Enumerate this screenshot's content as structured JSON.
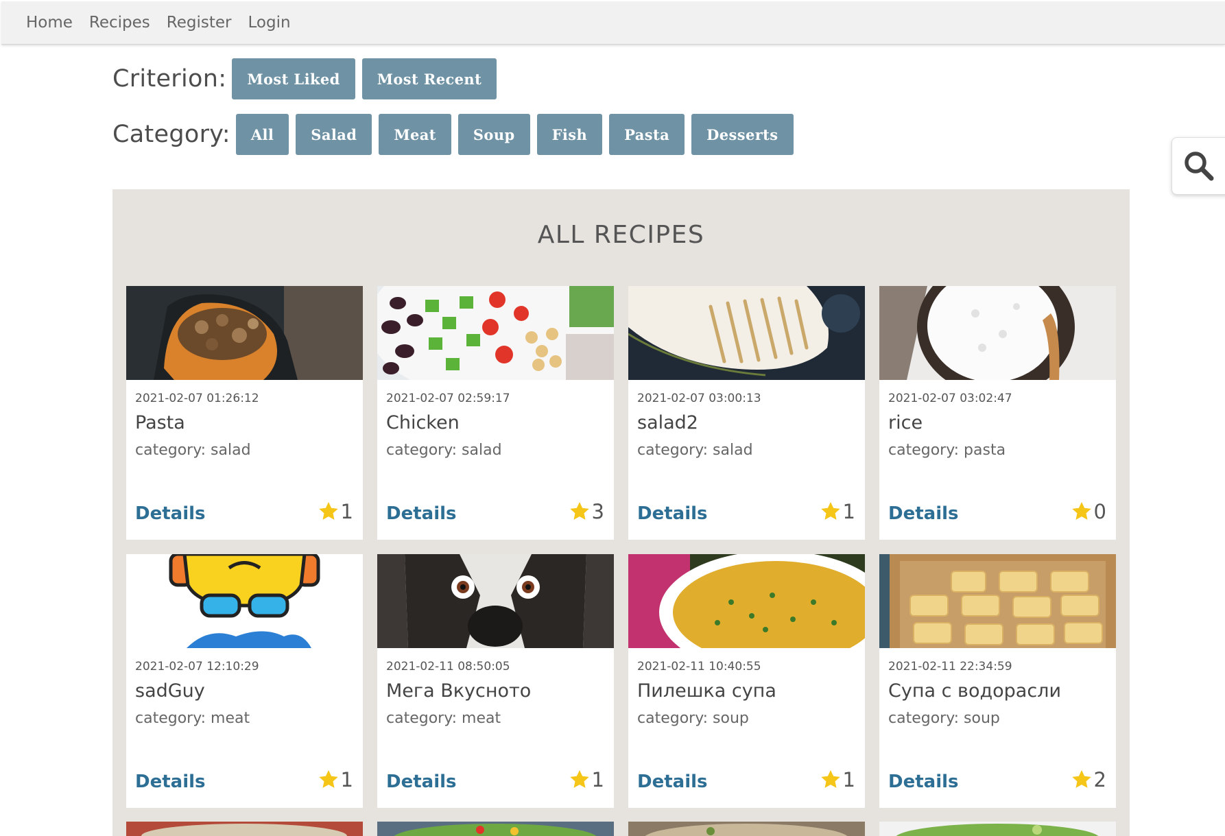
{
  "nav": {
    "items": [
      "Home",
      "Recipes",
      "Register",
      "Login"
    ]
  },
  "filters": {
    "criterion_label": "Criterion:",
    "criterion_buttons": [
      "Most Liked",
      "Most Recent"
    ],
    "category_label": "Category:",
    "category_buttons": [
      "All",
      "Salad",
      "Meat",
      "Soup",
      "Fish",
      "Pasta",
      "Desserts"
    ]
  },
  "search": {
    "icon": "search-icon"
  },
  "panel": {
    "title": "ALL RECIPES",
    "details_label": "Details",
    "recipes": [
      {
        "date": "2021-02-07 01:26:12",
        "title": "Pasta",
        "category": "category: salad",
        "likes": "1",
        "image": "stuffed-squash-mushrooms"
      },
      {
        "date": "2021-02-07 02:59:17",
        "title": "Chicken",
        "category": "category: salad",
        "likes": "3",
        "image": "vegetable-salad-bowl"
      },
      {
        "date": "2021-02-07 03:00:13",
        "title": "salad2",
        "category": "category: salad",
        "likes": "1",
        "image": "grilled-fish-fillet"
      },
      {
        "date": "2021-02-07 03:02:47",
        "title": "rice",
        "category": "category: pasta",
        "likes": "0",
        "image": "bowl-of-rice"
      },
      {
        "date": "2021-02-07 12:10:29",
        "title": "sadGuy",
        "category": "category: meat",
        "likes": "1",
        "image": "cartoon-character"
      },
      {
        "date": "2021-02-11 08:50:05",
        "title": "Мега Вкусното",
        "category": "category: meat",
        "likes": "1",
        "image": "husky-dog-face"
      },
      {
        "date": "2021-02-11 10:40:55",
        "title": "Пилешка супа",
        "category": "category: soup",
        "likes": "1",
        "image": "chicken-soup-bowl"
      },
      {
        "date": "2021-02-11 22:34:59",
        "title": "Супа с водорасли",
        "category": "category: soup",
        "likes": "2",
        "image": "baked-pastries-tray"
      }
    ]
  },
  "colors": {
    "button": "#6f92a4",
    "details_link": "#2d6e95",
    "panel_bg": "#e6e2dd",
    "star": "#f5c518"
  }
}
